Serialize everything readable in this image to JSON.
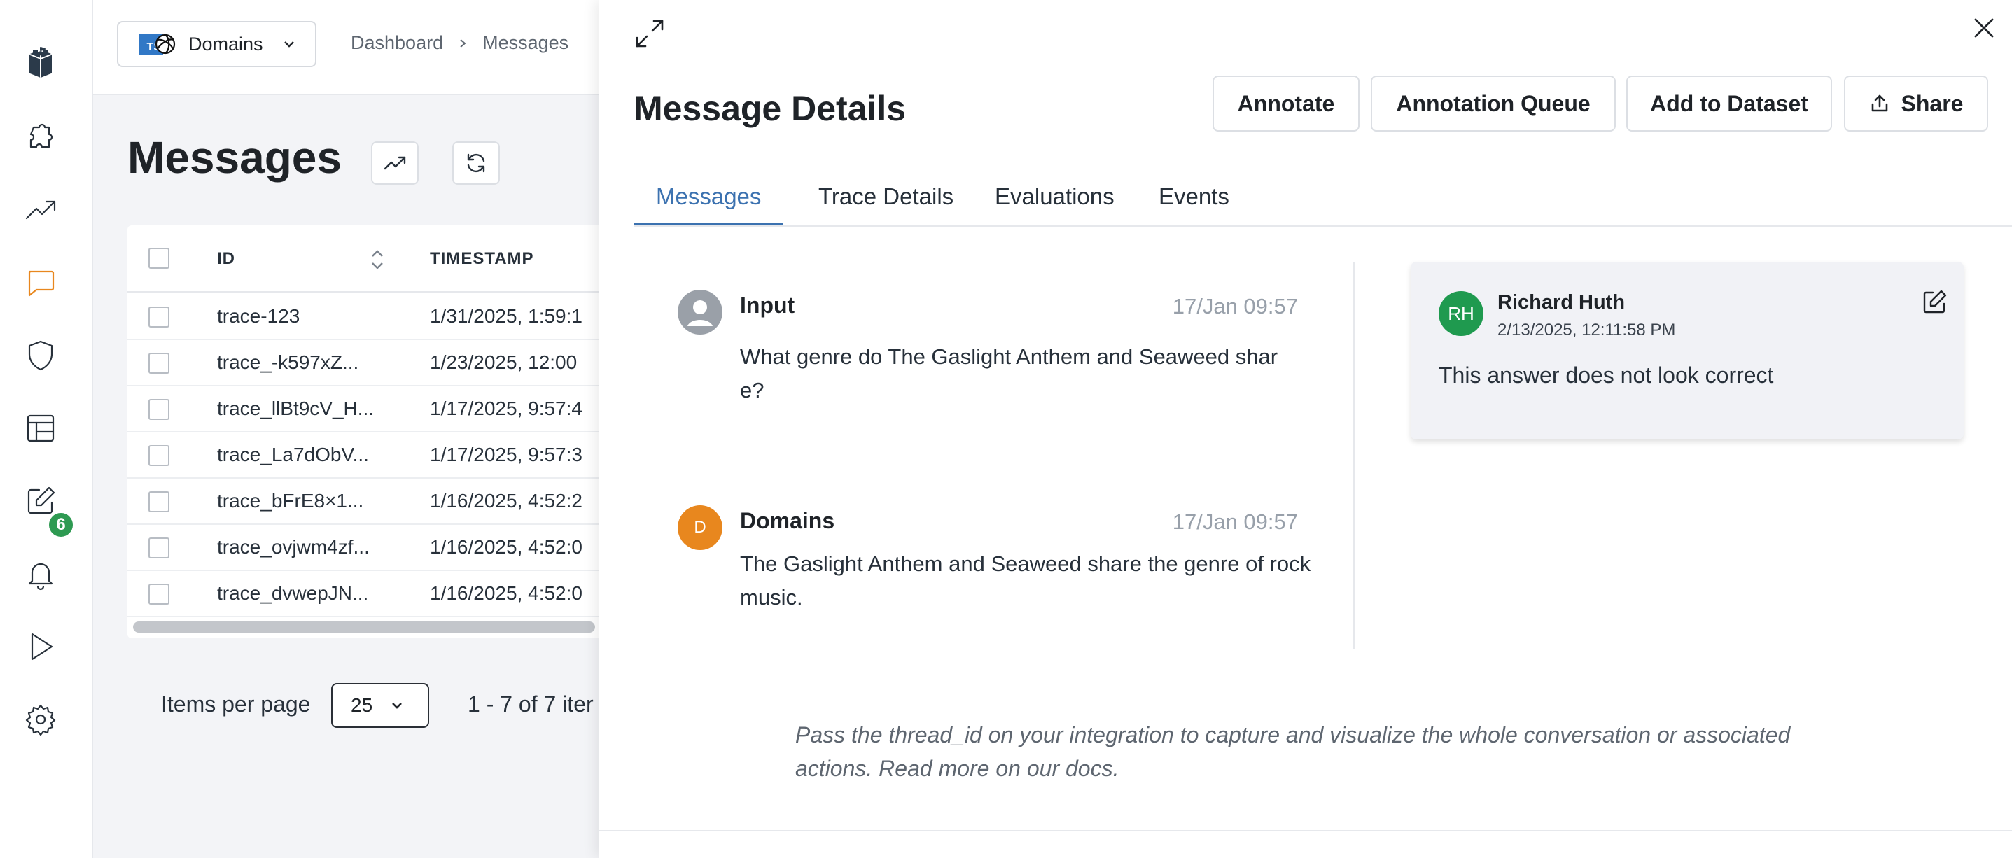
{
  "sidebar": {
    "items": [
      {
        "name": "logo",
        "icon": "castle-logo-icon"
      },
      {
        "name": "integrations",
        "icon": "puzzle-icon"
      },
      {
        "name": "analytics",
        "icon": "trending-up-icon"
      },
      {
        "name": "messages",
        "icon": "message-square-icon",
        "active": true
      },
      {
        "name": "guardrails",
        "icon": "shield-icon"
      },
      {
        "name": "datasets",
        "icon": "table-icon"
      },
      {
        "name": "annotations",
        "icon": "edit-icon"
      },
      {
        "name": "alerts",
        "icon": "bell-icon"
      },
      {
        "name": "playground",
        "icon": "play-icon"
      },
      {
        "name": "settings",
        "icon": "gear-icon"
      }
    ],
    "annotations_badge": "6",
    "accent": "#e8871e"
  },
  "topbar": {
    "domain_label": "Domains",
    "domain_logo_text": "TS",
    "breadcrumb": [
      "Dashboard",
      "Messages"
    ]
  },
  "main": {
    "title": "Messages",
    "table": {
      "columns": [
        "ID",
        "TIMESTAMP"
      ],
      "rows": [
        {
          "id": "trace-123",
          "timestamp": "1/31/2025, 1:59:1"
        },
        {
          "id": "trace_-k597xZ...",
          "timestamp": "1/23/2025, 12:00"
        },
        {
          "id": "trace_llBt9cV_H...",
          "timestamp": "1/17/2025, 9:57:4"
        },
        {
          "id": "trace_La7dObV...",
          "timestamp": "1/17/2025, 9:57:3"
        },
        {
          "id": "trace_bFrE8×1...",
          "timestamp": "1/16/2025, 4:52:2"
        },
        {
          "id": "trace_ovjwm4zf...",
          "timestamp": "1/16/2025, 4:52:0"
        },
        {
          "id": "trace_dvwepJN...",
          "timestamp": "1/16/2025, 4:52:0"
        }
      ]
    },
    "pagination": {
      "items_per_page_label": "Items per page",
      "items_per_page_value": "25",
      "count_text": "1 - 7 of 7 iter"
    }
  },
  "drawer": {
    "title": "Message Details",
    "buttons": {
      "annotate": "Annotate",
      "annotation_queue": "Annotation Queue",
      "add_to_dataset": "Add to Dataset",
      "share": "Share"
    },
    "tabs": [
      "Messages",
      "Trace Details",
      "Evaluations",
      "Events"
    ],
    "active_tab": "Messages",
    "messages": [
      {
        "sender": "Input",
        "time": "17/Jan 09:57",
        "text": "What genre do The Gaslight Anthem and Seaweed share?",
        "avatar": "user-icon",
        "avatar_color": "#9aa0a8"
      },
      {
        "sender": "Domains",
        "avatar_text": "D",
        "time": "17/Jan 09:57",
        "text": "The Gaslight Anthem and Seaweed share the genre of rock music.",
        "avatar_color": "#e8871e"
      }
    ],
    "note": {
      "initials": "RH",
      "author": "Richard Huth",
      "time": "2/13/2025, 12:11:58 PM",
      "text": "This answer does not look correct",
      "avatar_color": "#1f9a4f"
    },
    "hint": "Pass the thread_id on your integration to capture and visualize the whole conversation or associated actions. Read more on our docs."
  }
}
